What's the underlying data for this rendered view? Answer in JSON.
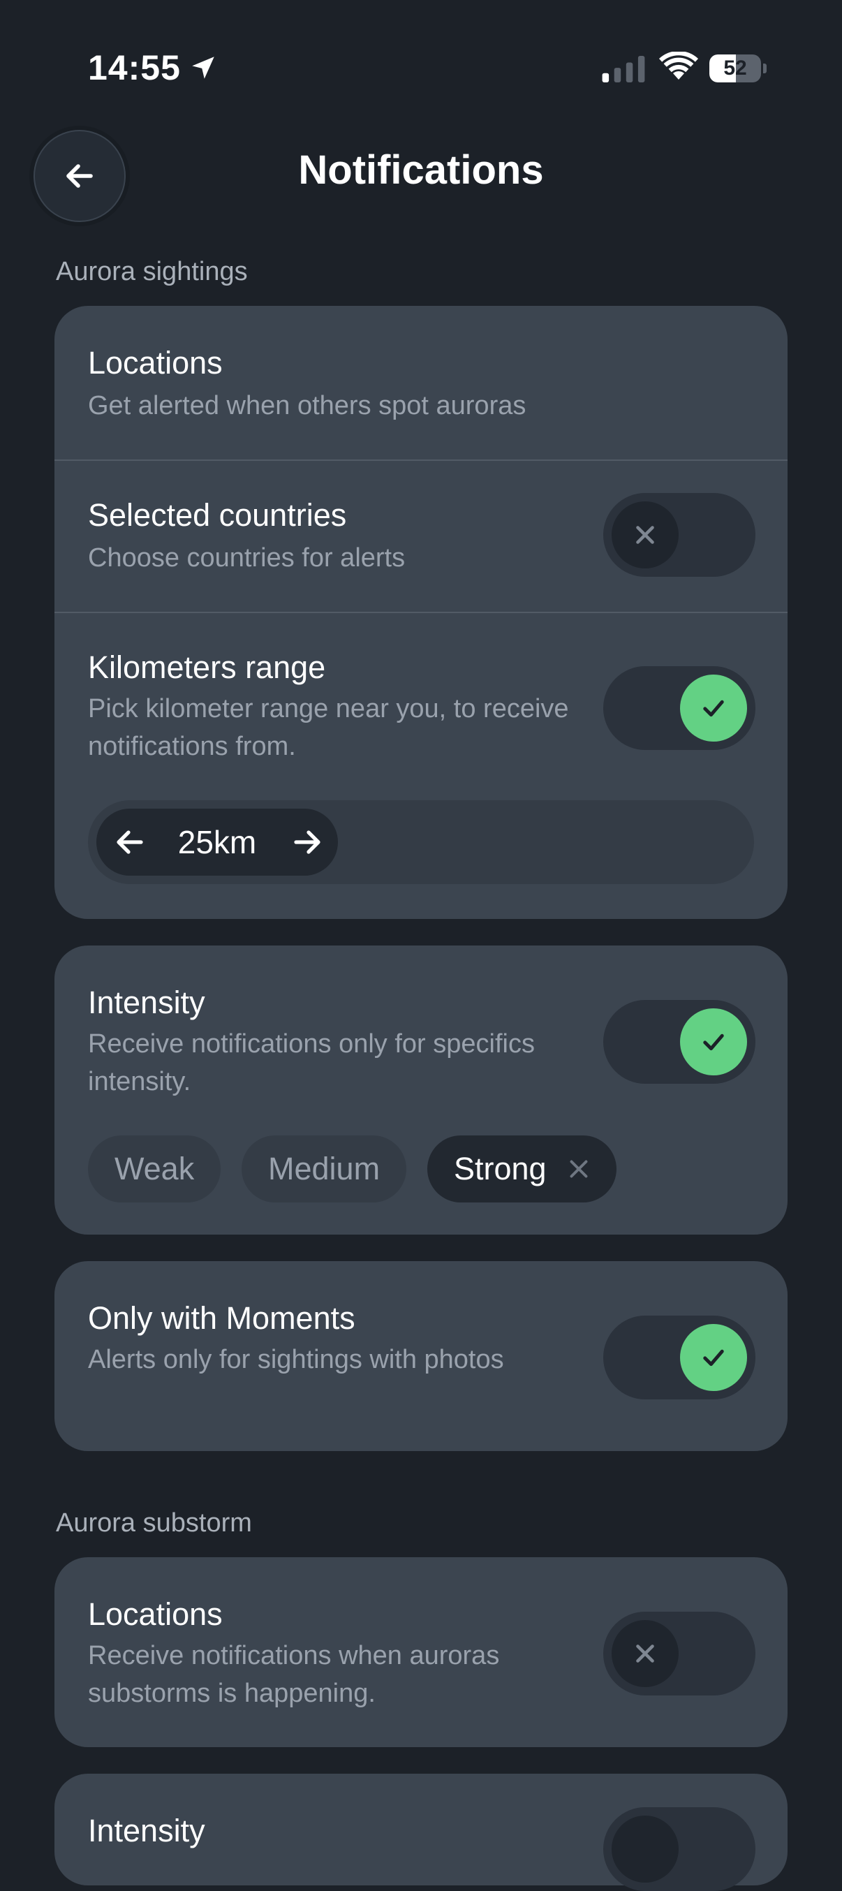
{
  "status_bar": {
    "time": "14:55",
    "battery_level": "52",
    "battery_fraction": 0.52
  },
  "header": {
    "title": "Notifications",
    "back_icon": "arrow-left-icon"
  },
  "sections": {
    "sightings": {
      "label": "Aurora sightings",
      "locations": {
        "title": "Locations",
        "subtitle": "Get alerted when others spot auroras"
      },
      "selected_countries": {
        "title": "Selected countries",
        "subtitle": "Choose countries for alerts",
        "enabled": false
      },
      "km_range": {
        "title": "Kilometers range",
        "subtitle": "Pick kilometer range near you, to receive notifications from.",
        "enabled": true,
        "value": "25km"
      },
      "intensity": {
        "title": "Intensity",
        "subtitle": "Receive notifications only for specifics intensity.",
        "enabled": true,
        "chips": [
          "Weak",
          "Medium",
          "Strong"
        ],
        "selected": "Strong"
      },
      "moments": {
        "title": "Only with Moments",
        "subtitle": "Alerts only for sightings with photos",
        "enabled": true
      }
    },
    "substorm": {
      "label": "Aurora substorm",
      "locations": {
        "title": "Locations",
        "subtitle": "Receive notifications when auroras substorms is happening.",
        "enabled": false
      },
      "intensity": {
        "title": "Intensity"
      }
    }
  },
  "colors": {
    "background": "#1c2128",
    "card": "#3c4550",
    "toggle_on": "#63d184",
    "toggle_off_knob": "#1f252d",
    "muted_text": "#9aa2ad"
  }
}
